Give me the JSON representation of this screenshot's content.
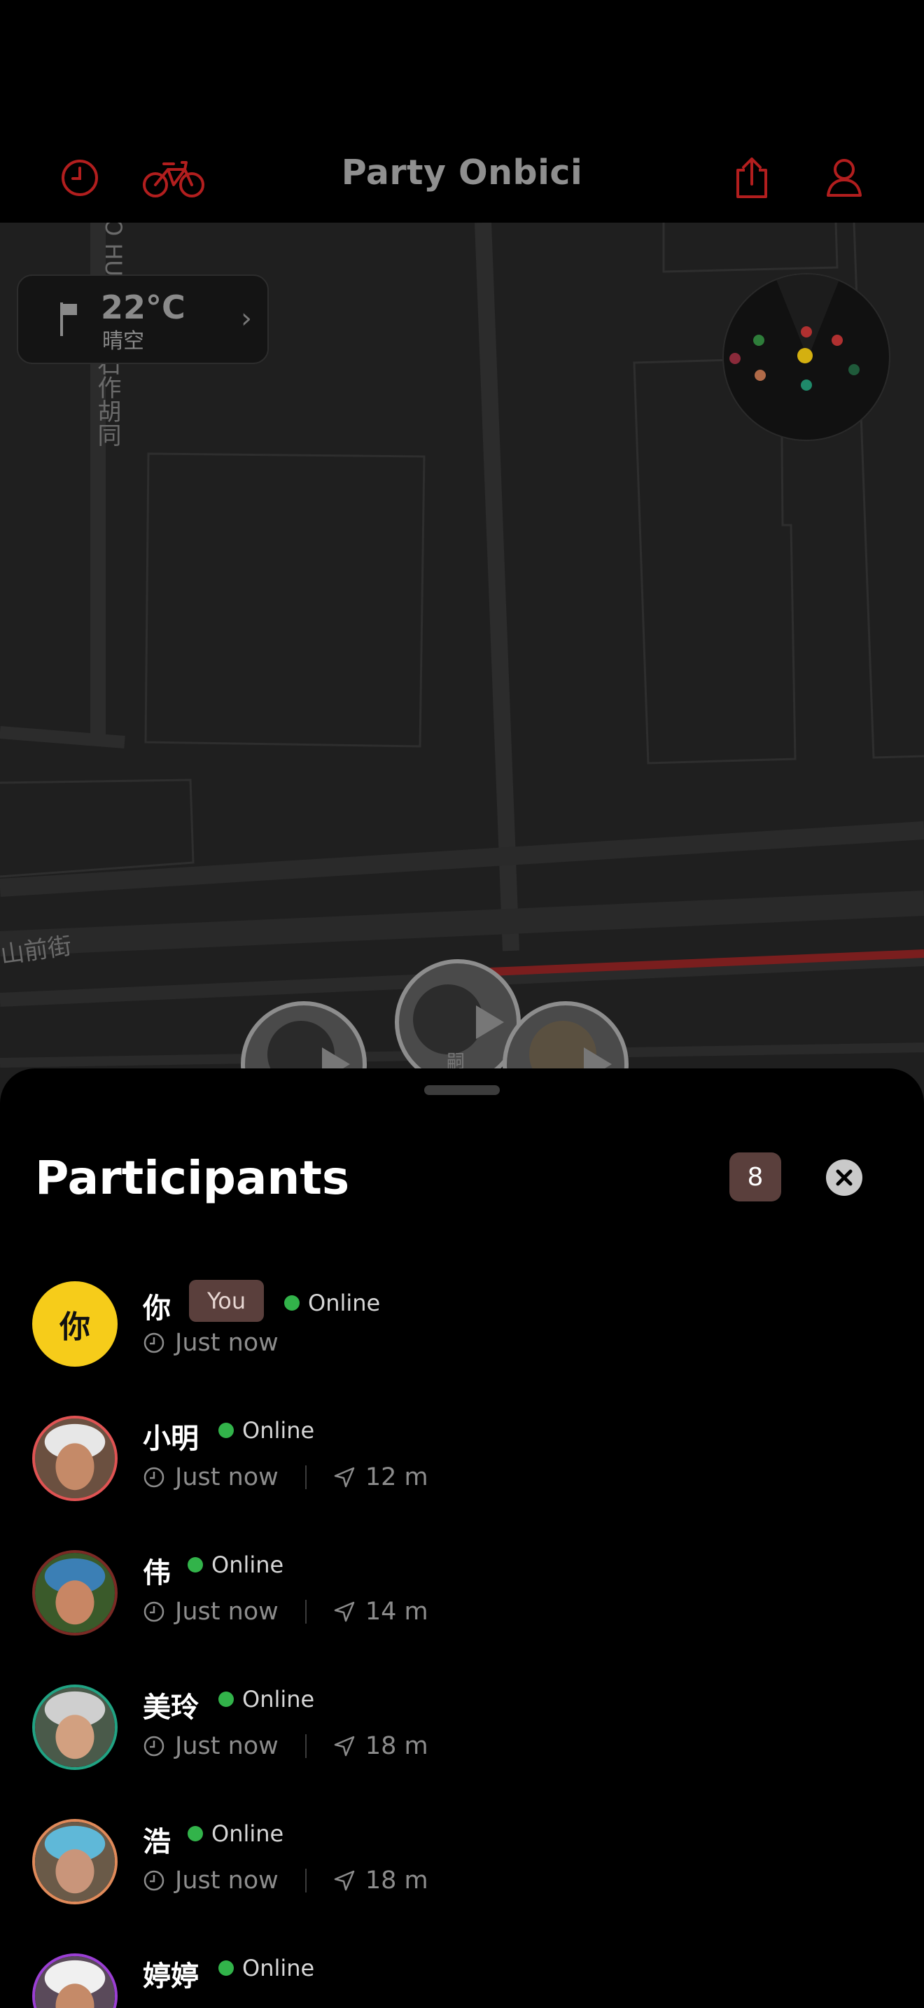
{
  "header": {
    "title": "Party Onbici",
    "accent_color": "#b21e1e",
    "icons": [
      "history-icon",
      "bike-icon",
      "share-icon",
      "profile-icon"
    ]
  },
  "map": {
    "weather": {
      "temperature": "22°C",
      "description": "晴空",
      "icon": "flag-icon"
    },
    "street_labels": {
      "label_1": "山前街",
      "label_2": "六石作胡同",
      "label_3": "O HU",
      "label_4": "嗣"
    }
  },
  "sheet": {
    "title": "Participants",
    "count": "8",
    "participants": [
      {
        "name": "你",
        "avatar_text": "你",
        "is_you": true,
        "you_label": "You",
        "status": "Online",
        "last_seen": "Just now",
        "distance": ""
      },
      {
        "name": "小明",
        "avatar_text": "",
        "is_you": false,
        "status": "Online",
        "last_seen": "Just now",
        "distance": "12 m",
        "ring_color": "#e05353"
      },
      {
        "name": "伟",
        "avatar_text": "",
        "is_you": false,
        "status": "Online",
        "last_seen": "Just now",
        "distance": "14 m",
        "ring_color": "#7b2a25"
      },
      {
        "name": "美玲",
        "avatar_text": "",
        "is_you": false,
        "status": "Online",
        "last_seen": "Just now",
        "distance": "18 m",
        "ring_color": "#21a383"
      },
      {
        "name": "浩",
        "avatar_text": "",
        "is_you": false,
        "status": "Online",
        "last_seen": "Just now",
        "distance": "18 m",
        "ring_color": "#e08a5a"
      },
      {
        "name": "婷婷",
        "avatar_text": "",
        "is_you": false,
        "status": "Online",
        "last_seen": "",
        "distance": "",
        "ring_color": "#9b3fd4"
      }
    ]
  }
}
